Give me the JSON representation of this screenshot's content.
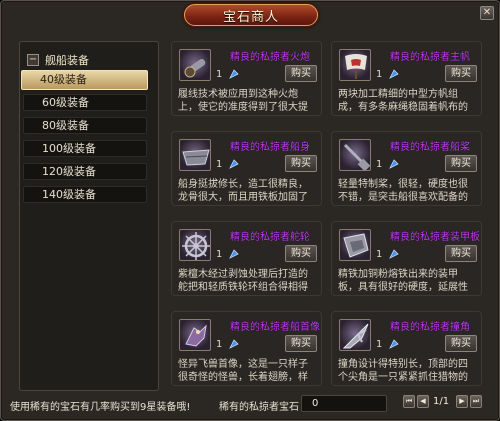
{
  "window": {
    "title": "宝石商人",
    "close_label": "✕"
  },
  "sidebar": {
    "category": {
      "toggle": "−",
      "label": "舰船装备"
    },
    "items": [
      {
        "label": "40级装备"
      },
      {
        "label": "60级装备"
      },
      {
        "label": "80级装备"
      },
      {
        "label": "100级装备"
      },
      {
        "label": "120级装备"
      },
      {
        "label": "140级装备"
      }
    ]
  },
  "items": [
    {
      "name": "精良的私掠者火炮",
      "qty": "1",
      "buy": "购买",
      "desc": "履线技术被应用到这种火炮上，使它的准度得到了很大提升，更...",
      "icon": "cannon-icon"
    },
    {
      "name": "精良的私掠者主帆",
      "qty": "1",
      "buy": "购买",
      "desc": "两块加工精细的中型方帆组成，有多条麻绳稳固着帆布的位置。...",
      "icon": "sail-icon"
    },
    {
      "name": "精良的私掠者船身",
      "qty": "1",
      "buy": "购买",
      "desc": "船身挺拔修长，造工很精良，龙骨很大，而且用铁板加固了底部...",
      "icon": "hull-icon"
    },
    {
      "name": "精良的私掠者船桨",
      "qty": "1",
      "buy": "购买",
      "desc": "轻量特制桨，很轻，硬度也很不错，是突击船很喜欢配备的桨。...",
      "icon": "oar-icon"
    },
    {
      "name": "精良的私掠者舵轮",
      "qty": "1",
      "buy": "购买",
      "desc": "紫檀木经过剥蚀处理后打造的舵把和轻质铁轮环组合得相得益彰...",
      "icon": "wheel-icon"
    },
    {
      "name": "精良的私掠者装甲板",
      "qty": "1",
      "buy": "购买",
      "desc": "精铁加铜粉熔铁出来的装甲板，具有很好的硬度，延展性也不错...",
      "icon": "armor-plate-icon"
    },
    {
      "name": "精良的私掠者船首像",
      "qty": "1",
      "buy": "购买",
      "desc": "怪异飞兽首像，这是一只样子很奇怪的怪兽，长着翅膀，样子却...",
      "icon": "figurehead-icon"
    },
    {
      "name": "精良的私掠者撞角",
      "qty": "1",
      "buy": "购买",
      "desc": "撞角设计得特别长，顶部的四个尖角是一只紧紧抓住猎物的爪子...",
      "icon": "ram-icon"
    }
  ],
  "footer": {
    "hint": "使用稀有的宝石有几率购买到9星装备哦!",
    "currency_label": "稀有的私掠者宝石",
    "currency_value": "0",
    "page": "1/1"
  },
  "colors": {
    "item_name": "#c03cf0",
    "accent_frame": "#e0a35a"
  }
}
